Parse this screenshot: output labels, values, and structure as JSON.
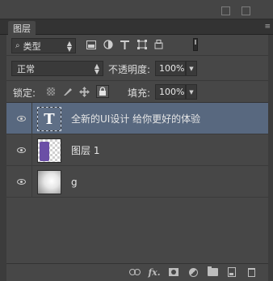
{
  "panel": {
    "tab_label": "图层",
    "menu_glyph": "≡"
  },
  "filter": {
    "kind_label": "类型",
    "lens_glyph": "⌕",
    "icons": [
      "image-filter-icon",
      "adjustment-filter-icon",
      "type-filter-icon",
      "shape-filter-icon",
      "smart-object-filter-icon"
    ]
  },
  "blend": {
    "mode": "正常",
    "opacity_label": "不透明度:",
    "opacity_value": "100%"
  },
  "lock": {
    "label": "锁定:",
    "fill_label": "填充:",
    "fill_value": "100%"
  },
  "layers": [
    {
      "name": "全新的UI设计 给你更好的体验",
      "kind": "text",
      "thumb_glyph": "T",
      "selected": true,
      "visible": true
    },
    {
      "name": "图层 1",
      "kind": "pixel",
      "selected": false,
      "visible": true
    },
    {
      "name": "g",
      "kind": "gradient",
      "selected": false,
      "visible": true
    }
  ],
  "footer": {
    "icons": [
      "link-layers-icon",
      "fx-icon",
      "add-mask-icon",
      "adjustment-layer-icon",
      "new-group-icon",
      "new-layer-icon",
      "delete-layer-icon"
    ],
    "fx_text": "fx."
  },
  "colors": {
    "panel_bg": "#474747",
    "selected_row": "#58687f",
    "header_bg": "#333333"
  }
}
